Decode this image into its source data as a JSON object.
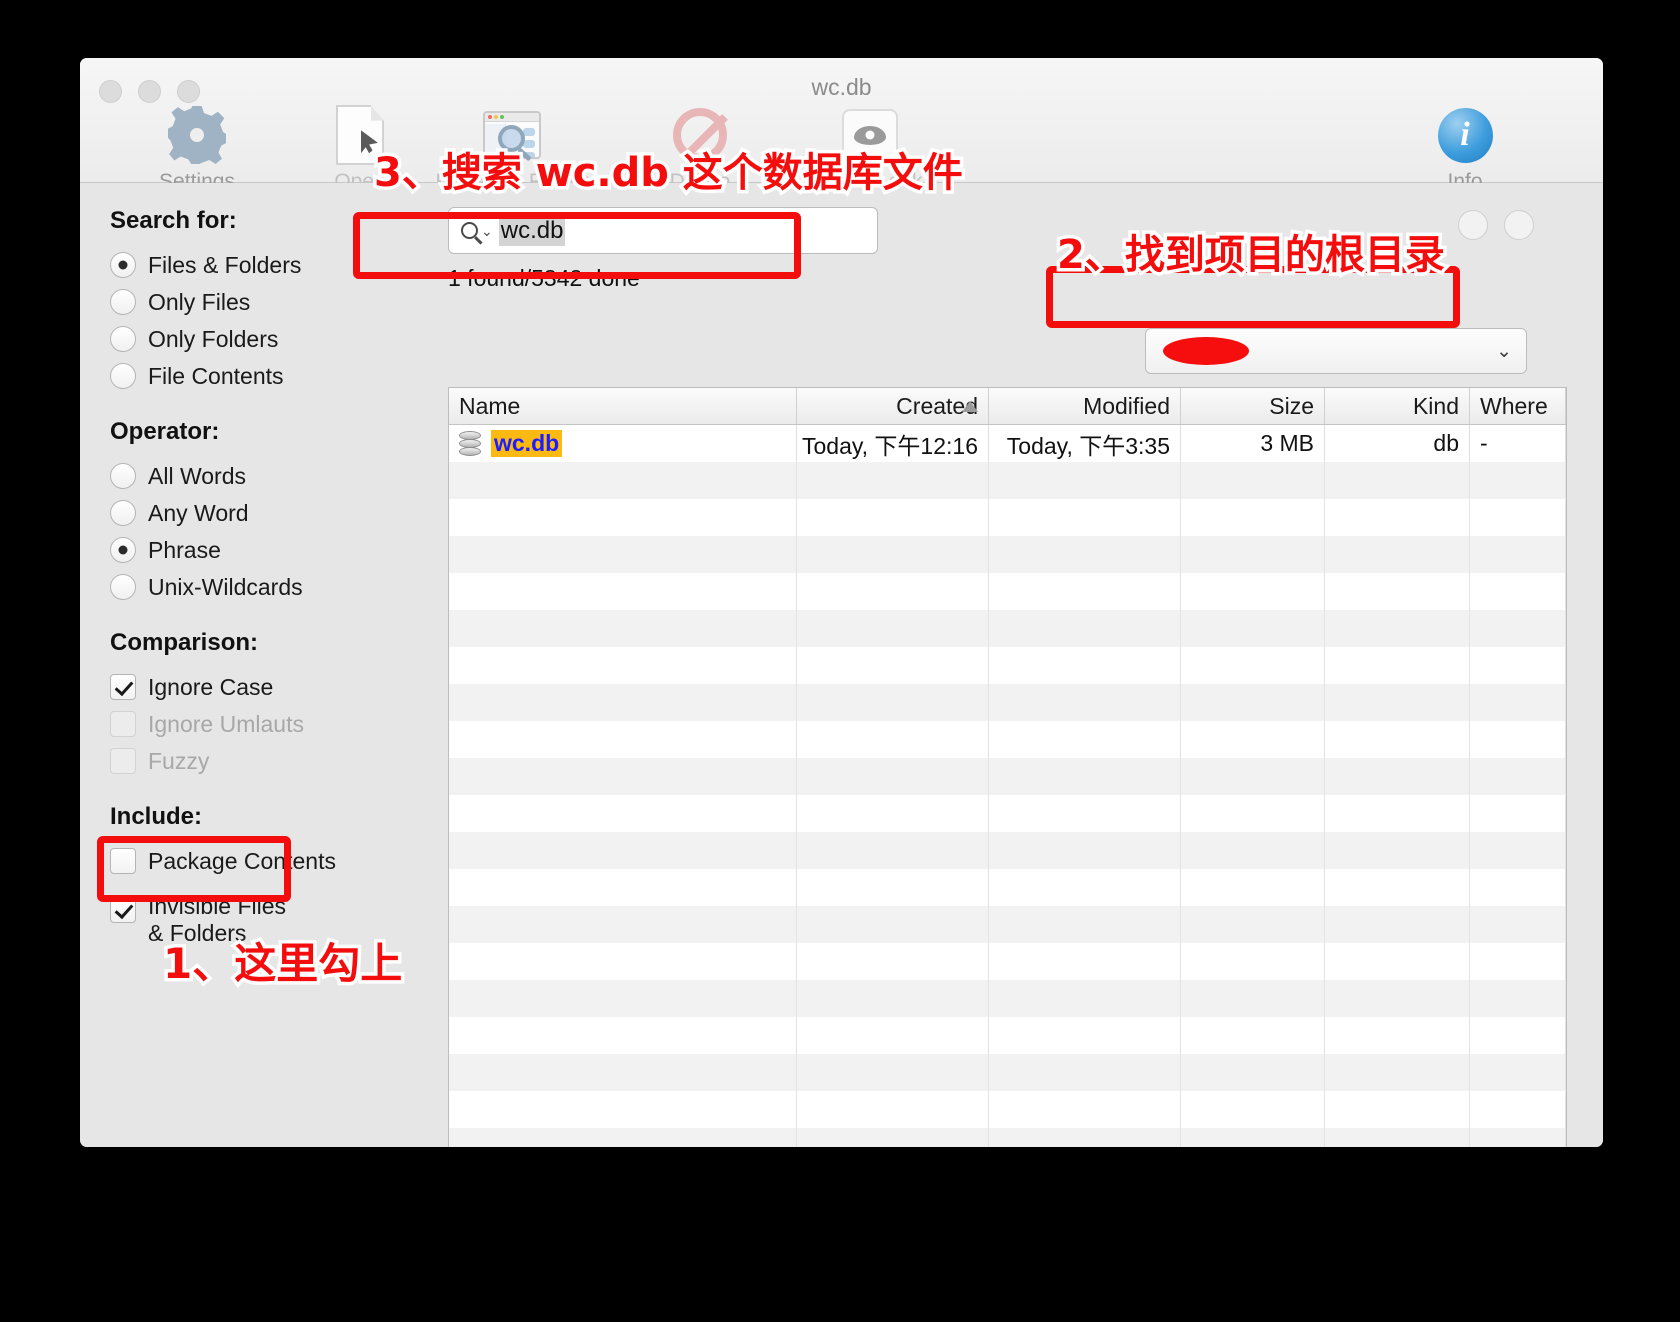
{
  "window": {
    "title": "wc.db"
  },
  "toolbar": {
    "items": [
      {
        "label": "Settings",
        "icon": "gear-icon",
        "enabled": true
      },
      {
        "label": "Open",
        "icon": "document-cursor-icon",
        "enabled": false
      },
      {
        "label": "Reveal in Finder",
        "icon": "reveal-in-finder-icon",
        "enabled": false
      },
      {
        "label": "Delete",
        "icon": "prohibit-icon",
        "enabled": false
      },
      {
        "label": "Quick Look",
        "icon": "eye-icon",
        "enabled": false
      },
      {
        "label": "Info",
        "icon": "info-circle-icon",
        "enabled": true
      }
    ]
  },
  "sidebar": {
    "groups": [
      {
        "title": "Search for:",
        "type": "radio",
        "options": [
          {
            "label": "Files & Folders",
            "selected": true,
            "enabled": true
          },
          {
            "label": "Only Files",
            "selected": false,
            "enabled": true
          },
          {
            "label": "Only Folders",
            "selected": false,
            "enabled": true
          },
          {
            "label": "File Contents",
            "selected": false,
            "enabled": true
          }
        ]
      },
      {
        "title": "Operator:",
        "type": "radio",
        "options": [
          {
            "label": "All Words",
            "selected": false,
            "enabled": true
          },
          {
            "label": "Any Word",
            "selected": false,
            "enabled": true
          },
          {
            "label": "Phrase",
            "selected": true,
            "enabled": true
          },
          {
            "label": "Unix-Wildcards",
            "selected": false,
            "enabled": true
          }
        ]
      },
      {
        "title": "Comparison:",
        "type": "check",
        "options": [
          {
            "label": "Ignore Case",
            "checked": true,
            "enabled": true
          },
          {
            "label": "Ignore Umlauts",
            "checked": false,
            "enabled": false
          },
          {
            "label": "Fuzzy",
            "checked": false,
            "enabled": false
          }
        ]
      },
      {
        "title": "Include:",
        "type": "check",
        "options": [
          {
            "label": "Package Contents",
            "checked": false,
            "enabled": true
          },
          {
            "label": "Invisible Files\n& Folders",
            "checked": true,
            "enabled": true,
            "highlighted": true
          }
        ]
      }
    ]
  },
  "search": {
    "value": "wc.db",
    "placeholder": "",
    "status": "1 found/5342 done"
  },
  "scope": {
    "value": "",
    "redacted": true,
    "chevron": "⌄"
  },
  "results": {
    "columns": [
      "Name",
      "Created",
      "Modified",
      "Size",
      "Kind",
      "Where"
    ],
    "sorted_column": "Created",
    "sort_direction": "ascending",
    "rows": [
      {
        "name": "wc.db",
        "created": "Today, 下午12:16",
        "modified": "Today, 下午3:35",
        "size": "3 MB",
        "kind": "db",
        "where": "-"
      }
    ]
  },
  "annotations": [
    {
      "id": "anno-3",
      "text": "3、搜索 wc.db 这个数据库文件"
    },
    {
      "id": "anno-2",
      "text": "2、找到项目的根目录"
    },
    {
      "id": "anno-1",
      "text": "1、这里勾上"
    }
  ],
  "colors": {
    "annotation_red": "#f40d0d",
    "highlight_orange": "#fcb912",
    "filename_blue": "#1c1cff",
    "info_blue": "#3e9ddd"
  }
}
